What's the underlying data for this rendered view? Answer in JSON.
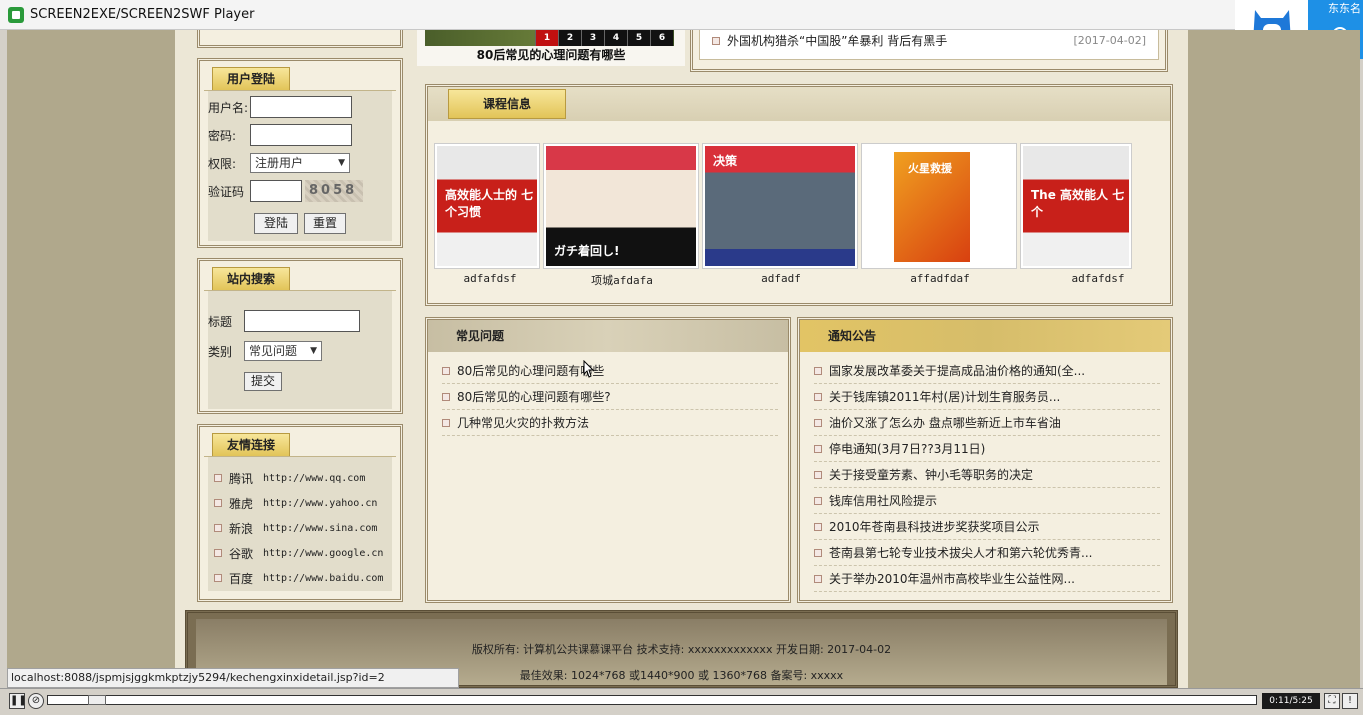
{
  "window": {
    "title": "SCREEN2EXE/SCREEN2SWF Player"
  },
  "overlay": {
    "brand": "东东名"
  },
  "login": {
    "tab": "用户登陆",
    "username_label": "用户名:",
    "password_label": "密码:",
    "role_label": "权限:",
    "role_value": "注册用户",
    "captcha_label": "验证码",
    "captcha_text": "8058",
    "login_button": "登陆",
    "reset_button": "重置"
  },
  "search": {
    "tab": "站内搜索",
    "title_label": "标题",
    "category_label": "类别",
    "category_value": "常见问题",
    "submit_button": "提交"
  },
  "links": {
    "tab": "友情连接",
    "items": [
      {
        "name": "腾讯",
        "url": "http://www.qq.com"
      },
      {
        "name": "雅虎",
        "url": "http://www.yahoo.cn"
      },
      {
        "name": "新浪",
        "url": "http://www.sina.com"
      },
      {
        "name": "谷歌",
        "url": "http://www.google.cn"
      },
      {
        "name": "百度",
        "url": "http://www.baidu.com"
      }
    ]
  },
  "carousel": {
    "pages": [
      "1",
      "2",
      "3",
      "4",
      "5",
      "6"
    ],
    "active_page": "1",
    "caption": "80后常见的心理问题有哪些"
  },
  "top_news": {
    "title": "外国机构猎杀“中国股”牟暴利 背后有黑手",
    "date": "[2017-04-02]"
  },
  "courses": {
    "tab": "课程信息",
    "items": [
      {
        "caption": "adfafdsf",
        "cover_text": "高效能人士的 七个习惯"
      },
      {
        "caption": "项城afdafa",
        "cover_text": "ガチ着回し!"
      },
      {
        "caption": "adfadf",
        "cover_text": "决策"
      },
      {
        "caption": "affadfdaf",
        "cover_text": "火星救援"
      },
      {
        "caption": "adfafdsf",
        "cover_text": "The 高效能人 七个"
      }
    ]
  },
  "faq": {
    "title": "常见问题",
    "items": [
      "80后常见的心理问题有哪些",
      "80后常见的心理问题有哪些?",
      "几种常见火灾的扑救方法"
    ]
  },
  "notice": {
    "title": "通知公告",
    "items": [
      "国家发展改革委关于提高成品油价格的通知(全...",
      "关于钱库镇2011年村(居)计划生育服务员...",
      "油价又涨了怎么办 盘点哪些新近上市车省油",
      "停电通知(3月7日??3月11日)",
      "关于接受童芳素、钟小毛等职务的决定",
      "钱库信用社风险提示",
      "2010年苍南县科技进步奖获奖项目公示",
      "苍南县第七轮专业技术拔尖人才和第六轮优秀青...",
      "关于举办2010年温州市高校毕业生公益性网..."
    ]
  },
  "footer": {
    "line1": "版权所有: 计算机公共课慕课平台 技术支持: xxxxxxxxxxxxx 开发日期: 2017-04-02",
    "line2": "最佳效果: 1024*768 或1440*900 或 1360*768 备案号: xxxxx"
  },
  "status_url": "localhost:8088/jspmjsjggkmkptzjy5294/kechengxinxidetail.jsp?id=2",
  "player": {
    "time": "0:11/5:25",
    "progress": 0.034
  }
}
